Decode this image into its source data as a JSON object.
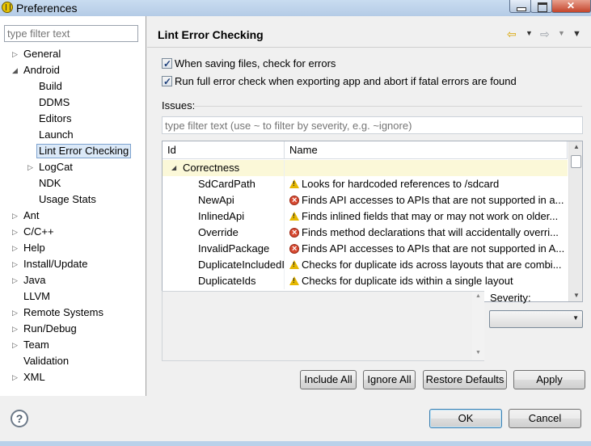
{
  "window": {
    "title": "Preferences"
  },
  "sidebar": {
    "filter_placeholder": "type filter text",
    "items": [
      {
        "label": "General",
        "arrow": "▷"
      },
      {
        "label": "Android",
        "arrow": "◢"
      },
      {
        "label": "Build",
        "arrow": ""
      },
      {
        "label": "DDMS",
        "arrow": ""
      },
      {
        "label": "Editors",
        "arrow": ""
      },
      {
        "label": "Launch",
        "arrow": ""
      },
      {
        "label": "Lint Error Checking",
        "arrow": ""
      },
      {
        "label": "LogCat",
        "arrow": "▷"
      },
      {
        "label": "NDK",
        "arrow": ""
      },
      {
        "label": "Usage Stats",
        "arrow": ""
      },
      {
        "label": "Ant",
        "arrow": "▷"
      },
      {
        "label": "C/C++",
        "arrow": "▷"
      },
      {
        "label": "Help",
        "arrow": "▷"
      },
      {
        "label": "Install/Update",
        "arrow": "▷"
      },
      {
        "label": "Java",
        "arrow": "▷"
      },
      {
        "label": "LLVM",
        "arrow": ""
      },
      {
        "label": "Remote Systems",
        "arrow": "▷"
      },
      {
        "label": "Run/Debug",
        "arrow": "▷"
      },
      {
        "label": "Team",
        "arrow": "▷"
      },
      {
        "label": "Validation",
        "arrow": ""
      },
      {
        "label": "XML",
        "arrow": "▷"
      }
    ]
  },
  "page": {
    "title": "Lint Error Checking",
    "check_on_save": "When saving files, check for errors",
    "check_on_export": "Run full error check when exporting app and abort if fatal errors are found",
    "issues_label": "Issues:",
    "issues_filter_placeholder": "type filter text (use ~ to filter by severity, e.g. ~ignore)",
    "columns": {
      "id": "Id",
      "name": "Name"
    },
    "group": "Correctness",
    "group_arrow": "◢",
    "rows": [
      {
        "id": "SdCardPath",
        "severity": "warning",
        "name": "Looks for hardcoded references to /sdcard"
      },
      {
        "id": "NewApi",
        "severity": "error",
        "name": "Finds API accesses to APIs that are not supported in a..."
      },
      {
        "id": "InlinedApi",
        "severity": "warning",
        "name": "Finds inlined fields that may or may not work on older..."
      },
      {
        "id": "Override",
        "severity": "error",
        "name": "Finds method declarations that will accidentally overri..."
      },
      {
        "id": "InvalidPackage",
        "severity": "error",
        "name": "Finds API accesses to APIs that are not supported in A..."
      },
      {
        "id": "DuplicateIncludedI",
        "severity": "warning",
        "name": "Checks for duplicate ids across layouts that are combi..."
      },
      {
        "id": "DuplicateIds",
        "severity": "warning",
        "name": "Checks for duplicate ids within a single layout"
      }
    ],
    "severity_label": "Severity:",
    "severity_value": ""
  },
  "buttons": {
    "include_all": "Include All",
    "ignore_all": "Ignore All",
    "restore_defaults": "Restore Defaults",
    "apply": "Apply",
    "ok": "OK",
    "cancel": "Cancel"
  }
}
